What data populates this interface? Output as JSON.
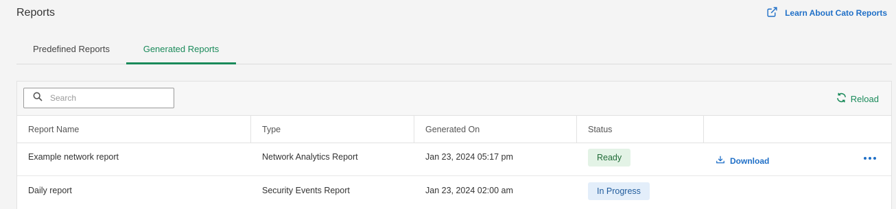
{
  "header": {
    "title": "Reports",
    "learn_link": "Learn About Cato Reports"
  },
  "tabs": [
    {
      "label": "Predefined Reports",
      "active": false
    },
    {
      "label": "Generated Reports",
      "active": true
    }
  ],
  "toolbar": {
    "search_placeholder": "Search",
    "reload_label": "Reload"
  },
  "table": {
    "columns": [
      "Report Name",
      "Type",
      "Generated On",
      "Status",
      ""
    ],
    "rows": [
      {
        "name": "Example network report",
        "type": "Network Analytics Report",
        "generated_on": "Jan 23, 2024 05:17 pm",
        "status": "Ready",
        "action": "Download"
      },
      {
        "name": "Daily report",
        "type": "Security Events Report",
        "generated_on": "Jan 23, 2024 02:00 am",
        "status": "In Progress",
        "action": ""
      }
    ]
  },
  "colors": {
    "accent_green": "#1a8a5a",
    "link_blue": "#1f6fc7",
    "ready_bg": "#e3f3e6",
    "progress_bg": "#e3eefa"
  },
  "icons": {
    "learn_link": "external-link-icon",
    "search": "search-icon",
    "reload": "reload-icon",
    "download": "download-icon",
    "more": "more-horizontal-icon"
  }
}
